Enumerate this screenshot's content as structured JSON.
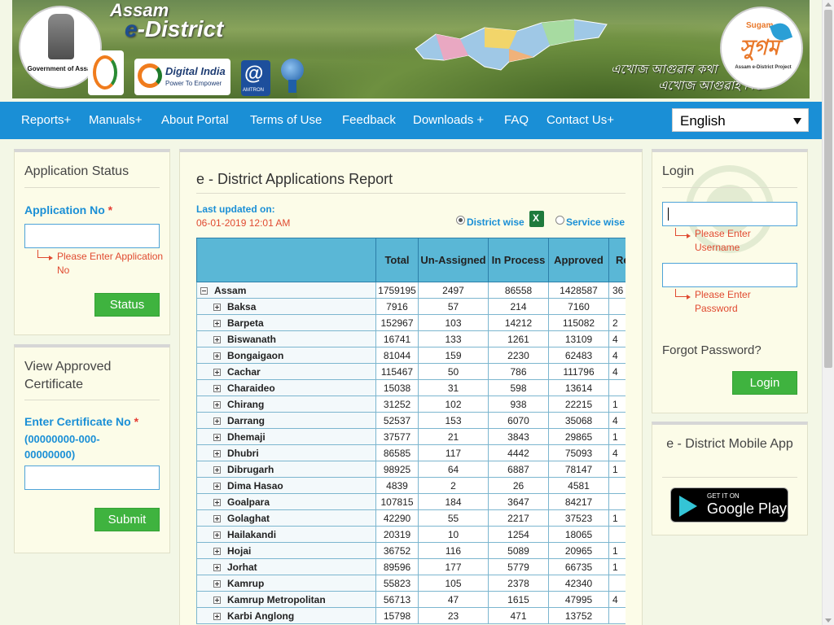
{
  "header": {
    "gov_caption": "Government of Assam",
    "brand_assam": "Assam",
    "brand_e": "e",
    "brand_district": "-District",
    "digital_india_title": "Digital India",
    "digital_india_sub": "Power To Empower",
    "amtron": "AMTRON",
    "sugam_small": "Sugam",
    "sugam_big": "সুগম",
    "sugam_caption": "Assam e-District Project",
    "slogan_line1": "এখোজ আগুৱাৰ কথা",
    "slogan_line2": "এখোজ আগুৱাই দিওঁ"
  },
  "nav": {
    "items": [
      "Reports+",
      "Manuals+",
      "About Portal",
      "Terms of Use",
      "Feedback",
      "Downloads +",
      "FAQ",
      "Contact Us+"
    ],
    "language": "English"
  },
  "app_status": {
    "title": "Application Status",
    "label": "Application No",
    "required": "*",
    "hint": "Please Enter Application No",
    "button": "Status"
  },
  "certificate": {
    "title": "View Approved Certificate",
    "label": "Enter Certificate No",
    "required": "*",
    "format": "(00000000-000-00000000)",
    "button": "Submit"
  },
  "report": {
    "title": "e - District Applications Report",
    "last_updated_label": "Last updated on:",
    "last_updated_value": "06-01-2019 12:01 AM",
    "radio_district": "District wise",
    "radio_service": "Service wise",
    "columns": [
      "",
      "Total",
      "Un-Assigned",
      "In Process",
      "Approved",
      "Rejected"
    ],
    "state": {
      "name": "Assam",
      "total": "1759195",
      "unassigned": "2497",
      "inprocess": "86558",
      "approved": "1428587",
      "rejected": "36"
    },
    "districts": [
      {
        "name": "Baksa",
        "total": "7916",
        "unassigned": "57",
        "inprocess": "214",
        "approved": "7160",
        "rejected": ""
      },
      {
        "name": "Barpeta",
        "total": "152967",
        "unassigned": "103",
        "inprocess": "14212",
        "approved": "115082",
        "rejected": "2"
      },
      {
        "name": "Biswanath",
        "total": "16741",
        "unassigned": "133",
        "inprocess": "1261",
        "approved": "13109",
        "rejected": "4"
      },
      {
        "name": "Bongaigaon",
        "total": "81044",
        "unassigned": "159",
        "inprocess": "2230",
        "approved": "62483",
        "rejected": "4"
      },
      {
        "name": "Cachar",
        "total": "115467",
        "unassigned": "50",
        "inprocess": "786",
        "approved": "111796",
        "rejected": "4"
      },
      {
        "name": "Charaideo",
        "total": "15038",
        "unassigned": "31",
        "inprocess": "598",
        "approved": "13614",
        "rejected": ""
      },
      {
        "name": "Chirang",
        "total": "31252",
        "unassigned": "102",
        "inprocess": "938",
        "approved": "22215",
        "rejected": "1"
      },
      {
        "name": "Darrang",
        "total": "52537",
        "unassigned": "153",
        "inprocess": "6070",
        "approved": "35068",
        "rejected": "4"
      },
      {
        "name": "Dhemaji",
        "total": "37577",
        "unassigned": "21",
        "inprocess": "3843",
        "approved": "29865",
        "rejected": "1"
      },
      {
        "name": "Dhubri",
        "total": "86585",
        "unassigned": "117",
        "inprocess": "4442",
        "approved": "75093",
        "rejected": "4"
      },
      {
        "name": "Dibrugarh",
        "total": "98925",
        "unassigned": "64",
        "inprocess": "6887",
        "approved": "78147",
        "rejected": "1"
      },
      {
        "name": "Dima Hasao",
        "total": "4839",
        "unassigned": "2",
        "inprocess": "26",
        "approved": "4581",
        "rejected": ""
      },
      {
        "name": "Goalpara",
        "total": "107815",
        "unassigned": "184",
        "inprocess": "3647",
        "approved": "84217",
        "rejected": ""
      },
      {
        "name": "Golaghat",
        "total": "42290",
        "unassigned": "55",
        "inprocess": "2217",
        "approved": "37523",
        "rejected": "1"
      },
      {
        "name": "Hailakandi",
        "total": "20319",
        "unassigned": "10",
        "inprocess": "1254",
        "approved": "18065",
        "rejected": ""
      },
      {
        "name": "Hojai",
        "total": "36752",
        "unassigned": "116",
        "inprocess": "5089",
        "approved": "20965",
        "rejected": "1"
      },
      {
        "name": "Jorhat",
        "total": "89596",
        "unassigned": "177",
        "inprocess": "5779",
        "approved": "66735",
        "rejected": "1"
      },
      {
        "name": "Kamrup",
        "total": "55823",
        "unassigned": "105",
        "inprocess": "2378",
        "approved": "42340",
        "rejected": ""
      },
      {
        "name": "Kamrup Metropolitan",
        "total": "56713",
        "unassigned": "47",
        "inprocess": "1615",
        "approved": "47995",
        "rejected": "4"
      },
      {
        "name": "Karbi Anglong",
        "total": "15798",
        "unassigned": "23",
        "inprocess": "471",
        "approved": "13752",
        "rejected": ""
      }
    ]
  },
  "login": {
    "title": "Login",
    "username_hint": "Please Enter Username",
    "password_hint": "Please Enter Password",
    "forgot": "Forgot Password?",
    "button": "Login"
  },
  "mobile": {
    "title": "e - District Mobile App",
    "badge_small": "GET IT ON",
    "badge_big": "Google Play"
  },
  "colors": {
    "nav": "#1a8fd6",
    "button": "#3fb33f",
    "table_header": "#5ab7d6",
    "hint": "#e04a30"
  }
}
